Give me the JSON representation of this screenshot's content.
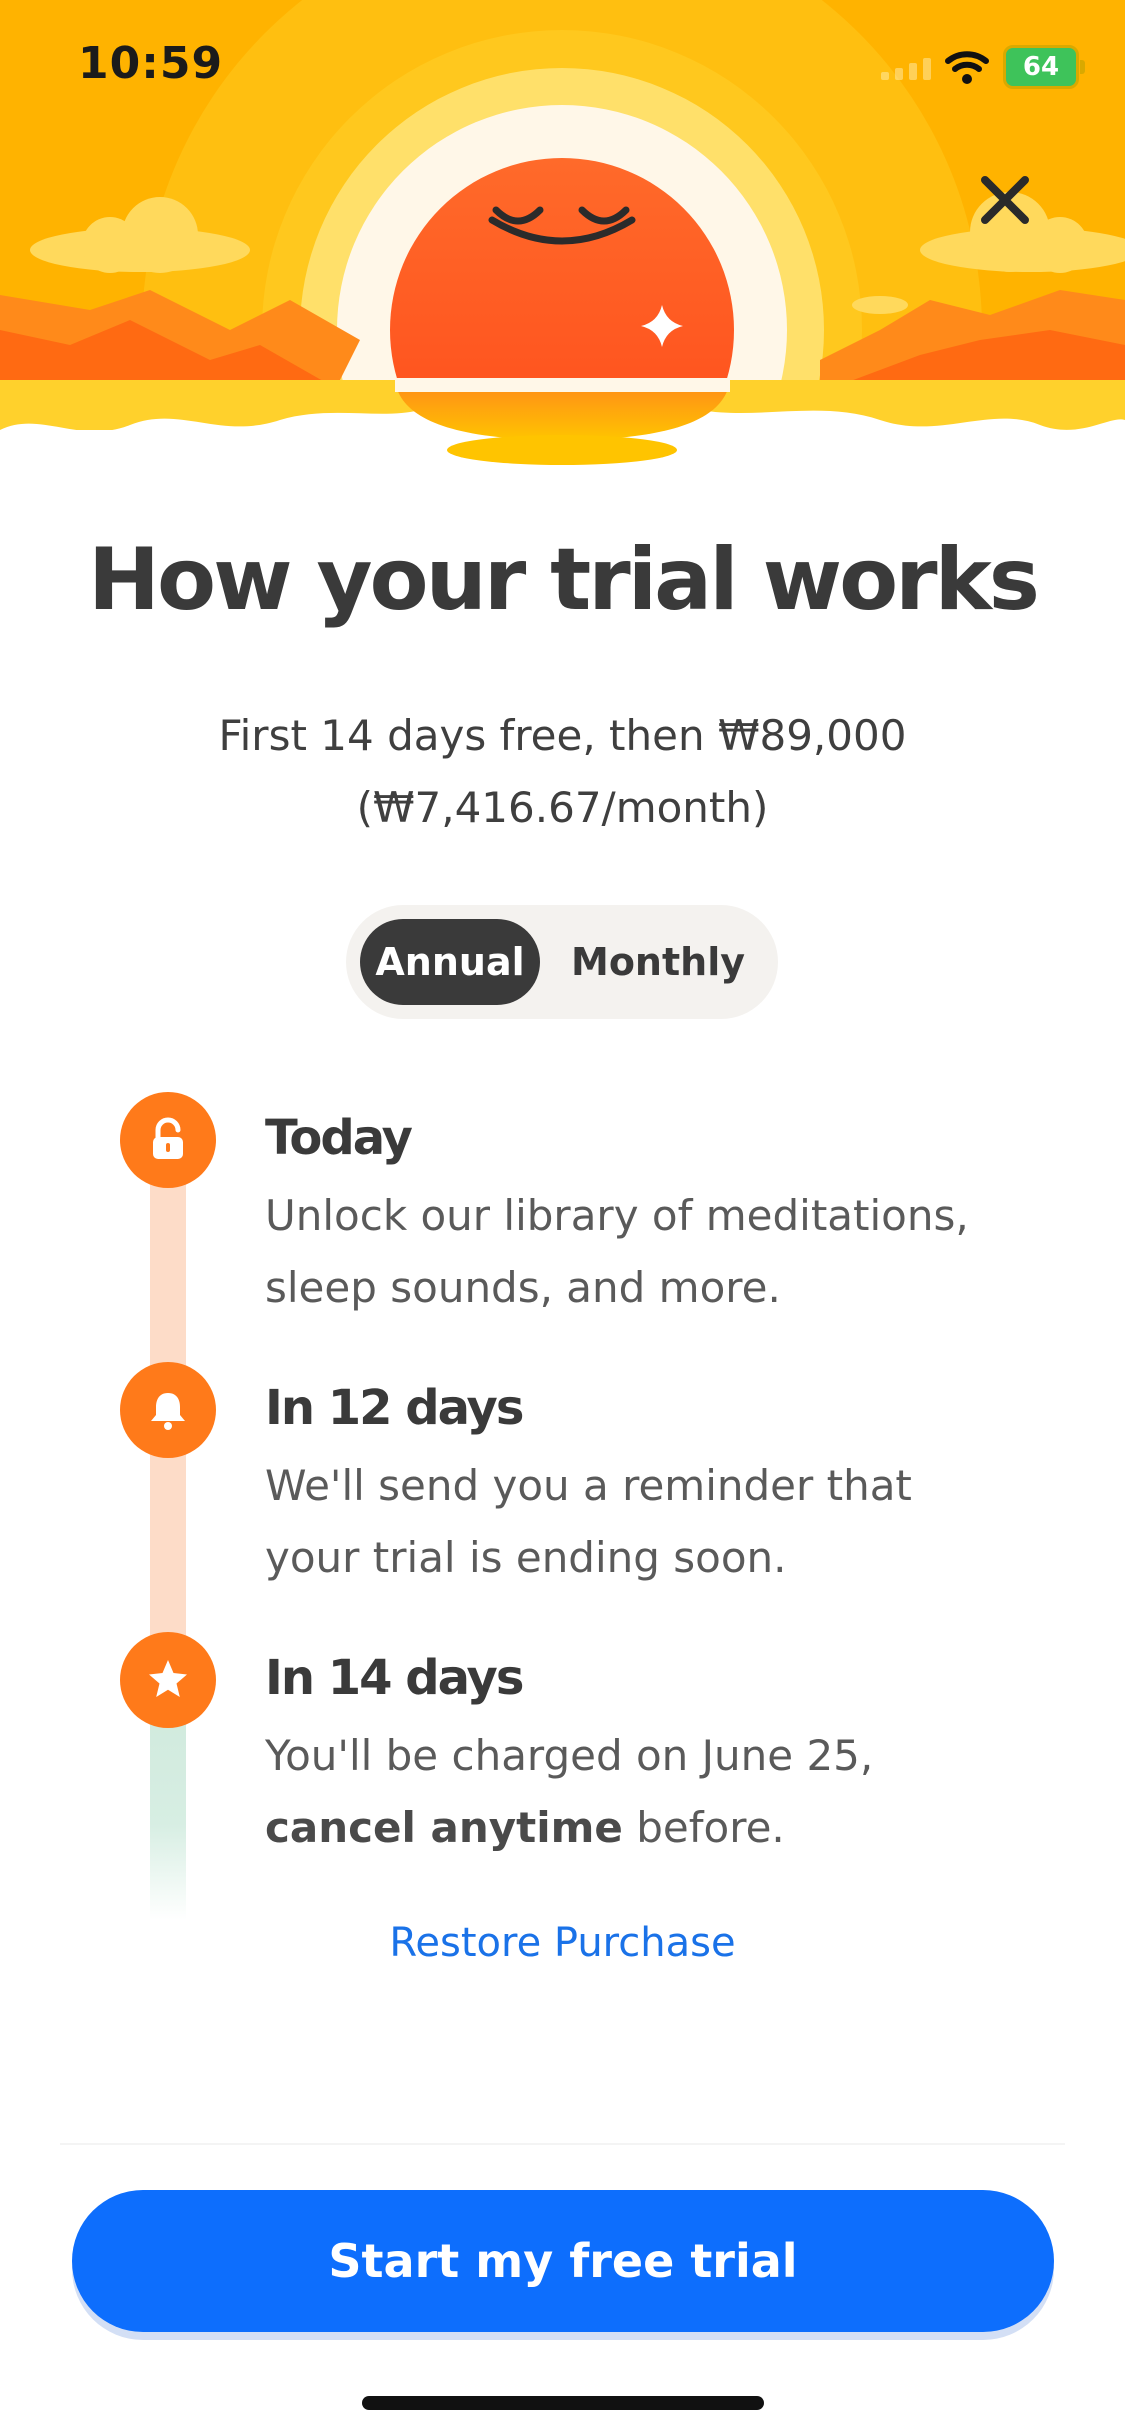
{
  "status_bar": {
    "time": "10:59",
    "battery": "64"
  },
  "header": {
    "close_icon": "close-icon"
  },
  "title": "How your trial works",
  "subtitle_line1": "First 14 days free, then ₩89,000",
  "subtitle_line2": "(₩7,416.67/month)",
  "plan_toggle": {
    "annual": "Annual",
    "monthly": "Monthly",
    "selected": "Annual"
  },
  "steps": [
    {
      "icon": "unlock-icon",
      "title": "Today",
      "line1": "Unlock our library of meditations,",
      "line2": "sleep sounds, and more."
    },
    {
      "icon": "bell-icon",
      "title": "In 12 days",
      "line1": "We'll send you a reminder that",
      "line2": "your trial is ending soon."
    },
    {
      "icon": "star-icon",
      "title": "In 14 days",
      "line1": "You'll be charged on June 25,",
      "line2_bold": "cancel anytime",
      "line2_rest": " before."
    }
  ],
  "restore_label": "Restore Purchase",
  "cta_label": "Start my free trial",
  "colors": {
    "accent_orange": "#ff7a1a",
    "cta_blue": "#0d6efd",
    "link_blue": "#1a72e8",
    "hero_yellow": "#ffb400"
  }
}
